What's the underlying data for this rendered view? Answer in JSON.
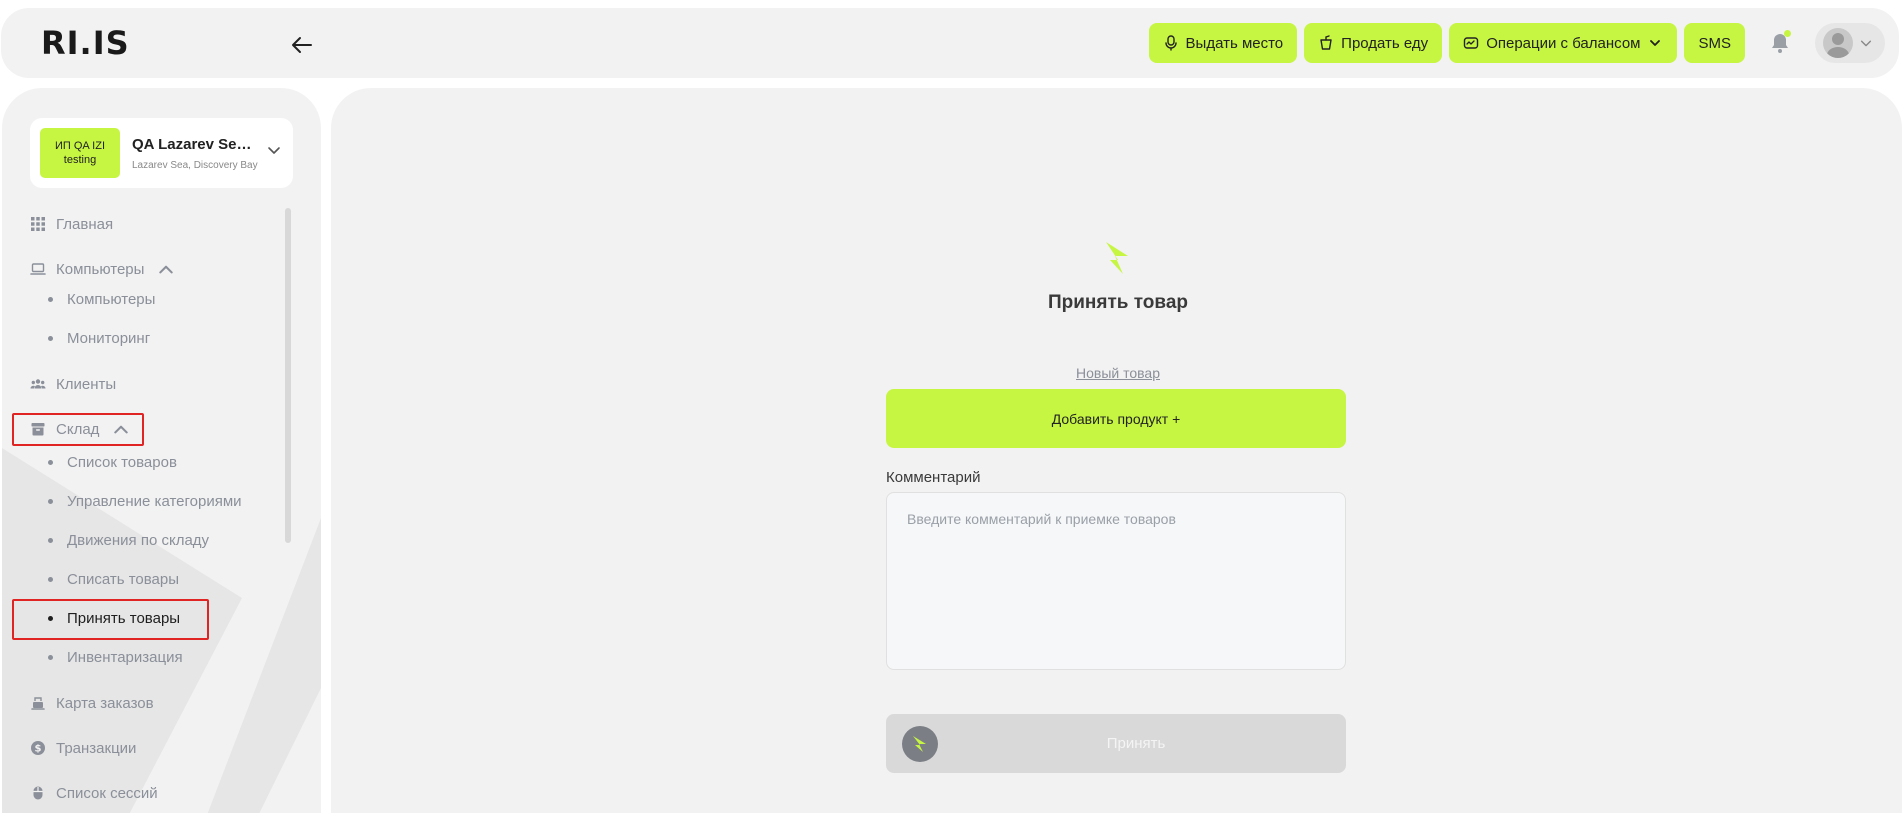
{
  "topbar": {
    "logo": "RI.IS",
    "actions": {
      "give_place": "Выдать место",
      "sell_food": "Продать еду",
      "balance_ops": "Операции с балансом",
      "sms": "SMS"
    }
  },
  "sidebar": {
    "org": {
      "badge_line1": "ИП QA IZI",
      "badge_line2": "testing",
      "name": "QA Lazarev Sea…",
      "address": "Lazarev Sea, Discovery Bay"
    },
    "items": {
      "home": "Главная",
      "computers": "Компьютеры",
      "computers_sub": [
        "Компьютеры",
        "Мониторинг"
      ],
      "clients": "Клиенты",
      "warehouse": "Склад",
      "warehouse_sub": [
        "Список товаров",
        "Управление категориями",
        "Движения по складу",
        "Списать товары",
        "Принять товары",
        "Инвентаризация"
      ],
      "orders_map": "Карта заказов",
      "transactions": "Транзакции",
      "sessions": "Список сессий"
    }
  },
  "main": {
    "title": "Принять товар",
    "new_product_link": "Новый товар",
    "add_product_button": "Добавить продукт +",
    "comment_label": "Комментарий",
    "comment_placeholder": "Введите комментарий к приемке товаров",
    "comment_value": "",
    "accept_button": "Принять"
  },
  "colors": {
    "accent": "#c6f542",
    "panel": "#f2f2f2",
    "muted_text": "#8a8f99",
    "highlight": "#e02424"
  }
}
